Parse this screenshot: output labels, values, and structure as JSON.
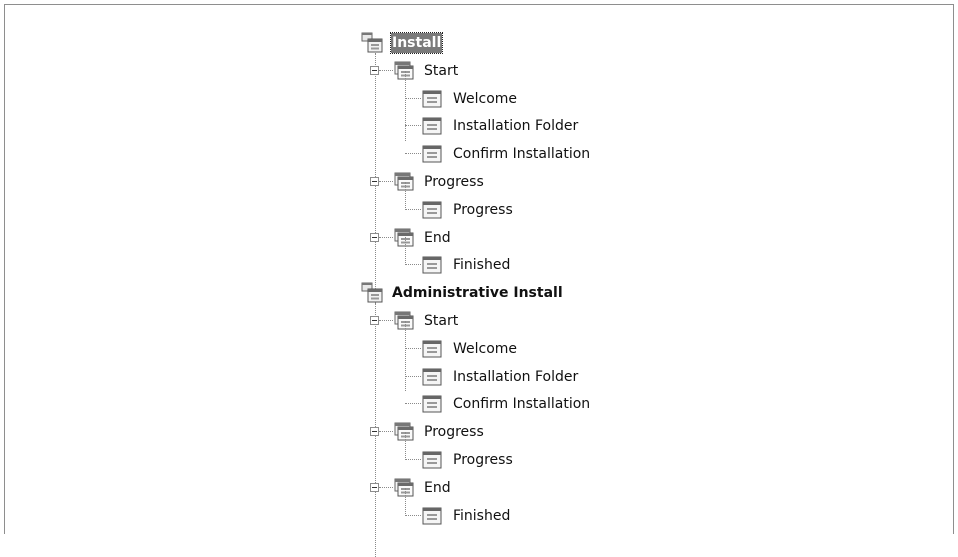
{
  "tree": {
    "roots": [
      {
        "label": "Install",
        "selected": true,
        "children": [
          {
            "label": "Start",
            "children": [
              {
                "label": "Welcome"
              },
              {
                "label": "Installation Folder"
              },
              {
                "label": "Confirm Installation"
              }
            ]
          },
          {
            "label": "Progress",
            "children": [
              {
                "label": "Progress"
              }
            ]
          },
          {
            "label": "End",
            "children": [
              {
                "label": "Finished"
              }
            ]
          }
        ]
      },
      {
        "label": "Administrative Install",
        "selected": false,
        "children": [
          {
            "label": "Start",
            "children": [
              {
                "label": "Welcome"
              },
              {
                "label": "Installation Folder"
              },
              {
                "label": "Confirm Installation"
              }
            ]
          },
          {
            "label": "Progress",
            "children": [
              {
                "label": "Progress"
              }
            ]
          },
          {
            "label": "End",
            "children": [
              {
                "label": "Finished"
              }
            ]
          }
        ]
      }
    ]
  }
}
